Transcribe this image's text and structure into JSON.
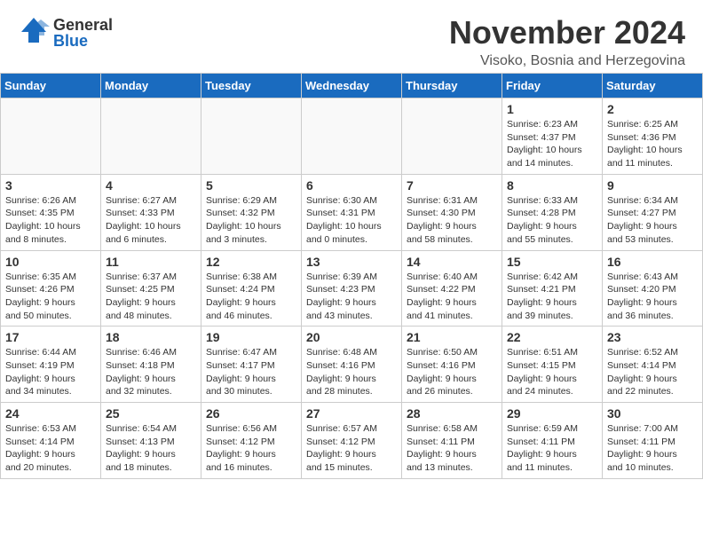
{
  "header": {
    "logo_general": "General",
    "logo_blue": "Blue",
    "title": "November 2024",
    "location": "Visoko, Bosnia and Herzegovina"
  },
  "weekdays": [
    "Sunday",
    "Monday",
    "Tuesday",
    "Wednesday",
    "Thursday",
    "Friday",
    "Saturday"
  ],
  "weeks": [
    [
      {
        "day": "",
        "info": "",
        "empty": true
      },
      {
        "day": "",
        "info": "",
        "empty": true
      },
      {
        "day": "",
        "info": "",
        "empty": true
      },
      {
        "day": "",
        "info": "",
        "empty": true
      },
      {
        "day": "",
        "info": "",
        "empty": true
      },
      {
        "day": "1",
        "info": "Sunrise: 6:23 AM\nSunset: 4:37 PM\nDaylight: 10 hours\nand 14 minutes."
      },
      {
        "day": "2",
        "info": "Sunrise: 6:25 AM\nSunset: 4:36 PM\nDaylight: 10 hours\nand 11 minutes."
      }
    ],
    [
      {
        "day": "3",
        "info": "Sunrise: 6:26 AM\nSunset: 4:35 PM\nDaylight: 10 hours\nand 8 minutes."
      },
      {
        "day": "4",
        "info": "Sunrise: 6:27 AM\nSunset: 4:33 PM\nDaylight: 10 hours\nand 6 minutes."
      },
      {
        "day": "5",
        "info": "Sunrise: 6:29 AM\nSunset: 4:32 PM\nDaylight: 10 hours\nand 3 minutes."
      },
      {
        "day": "6",
        "info": "Sunrise: 6:30 AM\nSunset: 4:31 PM\nDaylight: 10 hours\nand 0 minutes."
      },
      {
        "day": "7",
        "info": "Sunrise: 6:31 AM\nSunset: 4:30 PM\nDaylight: 9 hours\nand 58 minutes."
      },
      {
        "day": "8",
        "info": "Sunrise: 6:33 AM\nSunset: 4:28 PM\nDaylight: 9 hours\nand 55 minutes."
      },
      {
        "day": "9",
        "info": "Sunrise: 6:34 AM\nSunset: 4:27 PM\nDaylight: 9 hours\nand 53 minutes."
      }
    ],
    [
      {
        "day": "10",
        "info": "Sunrise: 6:35 AM\nSunset: 4:26 PM\nDaylight: 9 hours\nand 50 minutes."
      },
      {
        "day": "11",
        "info": "Sunrise: 6:37 AM\nSunset: 4:25 PM\nDaylight: 9 hours\nand 48 minutes."
      },
      {
        "day": "12",
        "info": "Sunrise: 6:38 AM\nSunset: 4:24 PM\nDaylight: 9 hours\nand 46 minutes."
      },
      {
        "day": "13",
        "info": "Sunrise: 6:39 AM\nSunset: 4:23 PM\nDaylight: 9 hours\nand 43 minutes."
      },
      {
        "day": "14",
        "info": "Sunrise: 6:40 AM\nSunset: 4:22 PM\nDaylight: 9 hours\nand 41 minutes."
      },
      {
        "day": "15",
        "info": "Sunrise: 6:42 AM\nSunset: 4:21 PM\nDaylight: 9 hours\nand 39 minutes."
      },
      {
        "day": "16",
        "info": "Sunrise: 6:43 AM\nSunset: 4:20 PM\nDaylight: 9 hours\nand 36 minutes."
      }
    ],
    [
      {
        "day": "17",
        "info": "Sunrise: 6:44 AM\nSunset: 4:19 PM\nDaylight: 9 hours\nand 34 minutes."
      },
      {
        "day": "18",
        "info": "Sunrise: 6:46 AM\nSunset: 4:18 PM\nDaylight: 9 hours\nand 32 minutes."
      },
      {
        "day": "19",
        "info": "Sunrise: 6:47 AM\nSunset: 4:17 PM\nDaylight: 9 hours\nand 30 minutes."
      },
      {
        "day": "20",
        "info": "Sunrise: 6:48 AM\nSunset: 4:16 PM\nDaylight: 9 hours\nand 28 minutes."
      },
      {
        "day": "21",
        "info": "Sunrise: 6:50 AM\nSunset: 4:16 PM\nDaylight: 9 hours\nand 26 minutes."
      },
      {
        "day": "22",
        "info": "Sunrise: 6:51 AM\nSunset: 4:15 PM\nDaylight: 9 hours\nand 24 minutes."
      },
      {
        "day": "23",
        "info": "Sunrise: 6:52 AM\nSunset: 4:14 PM\nDaylight: 9 hours\nand 22 minutes."
      }
    ],
    [
      {
        "day": "24",
        "info": "Sunrise: 6:53 AM\nSunset: 4:14 PM\nDaylight: 9 hours\nand 20 minutes."
      },
      {
        "day": "25",
        "info": "Sunrise: 6:54 AM\nSunset: 4:13 PM\nDaylight: 9 hours\nand 18 minutes."
      },
      {
        "day": "26",
        "info": "Sunrise: 6:56 AM\nSunset: 4:12 PM\nDaylight: 9 hours\nand 16 minutes."
      },
      {
        "day": "27",
        "info": "Sunrise: 6:57 AM\nSunset: 4:12 PM\nDaylight: 9 hours\nand 15 minutes."
      },
      {
        "day": "28",
        "info": "Sunrise: 6:58 AM\nSunset: 4:11 PM\nDaylight: 9 hours\nand 13 minutes."
      },
      {
        "day": "29",
        "info": "Sunrise: 6:59 AM\nSunset: 4:11 PM\nDaylight: 9 hours\nand 11 minutes."
      },
      {
        "day": "30",
        "info": "Sunrise: 7:00 AM\nSunset: 4:11 PM\nDaylight: 9 hours\nand 10 minutes."
      }
    ]
  ]
}
